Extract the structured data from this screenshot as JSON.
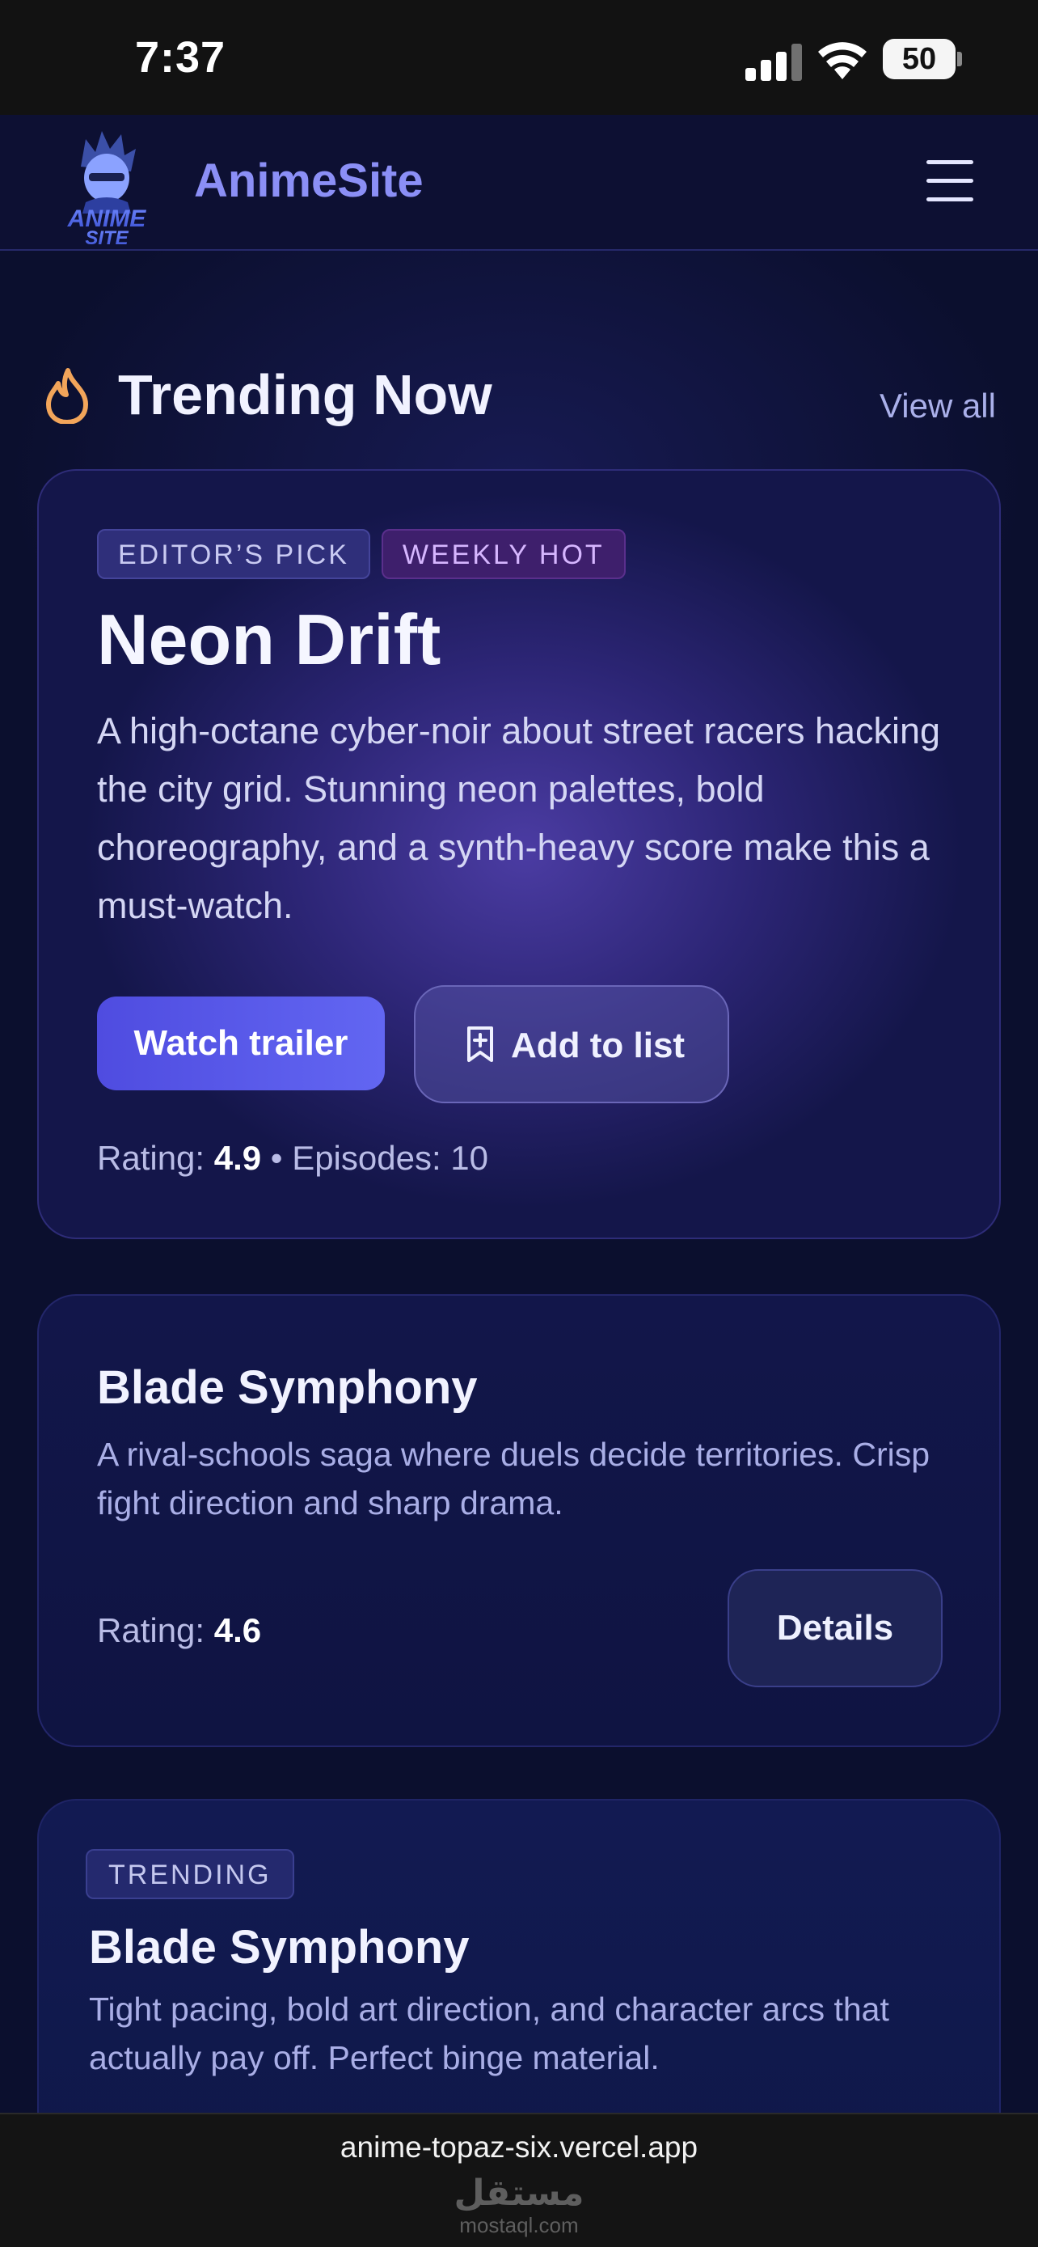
{
  "status_bar": {
    "time": "7:37",
    "battery": "50"
  },
  "header": {
    "logo_text_line1": "ANIME",
    "logo_text_line2": "SITE",
    "brand": "AnimeSite"
  },
  "section": {
    "title": "Trending Now",
    "view_all": "View all"
  },
  "featured": {
    "badges": [
      "EDITOR’S PICK",
      "WEEKLY HOT"
    ],
    "title": "Neon Drift",
    "description": "A high-octane cyber-noir about street racers hacking the city grid. Stunning neon palettes, bold choreography, and a synth-heavy score make this a must-watch.",
    "watch_trailer": "Watch trailer",
    "add_to_list": "Add to list",
    "rating_label": "Rating: ",
    "rating": "4.9",
    "separator": " • ",
    "episodes": "Episodes: 10"
  },
  "card_blade": {
    "title": "Blade Symphony",
    "description": "A rival-schools saga where duels decide territories. Crisp fight direction and sharp drama.",
    "rating_label": "Rating: ",
    "rating": "4.6",
    "details": "Details"
  },
  "card_trending": {
    "badge": "TRENDING",
    "title": "Blade Symphony",
    "description": "Tight pacing, bold art direction, and character arcs that actually pay off. Perfect binge material."
  },
  "browser": {
    "url": "anime-topaz-six.vercel.app",
    "watermark_arabic": "مستقل",
    "watermark_latin": "mostaql.com"
  },
  "colors": {
    "accent": "#5b5cf0",
    "background": "#0b0f2e",
    "brand": "#8b8ff6",
    "fire": "#f2a55a"
  },
  "icons": [
    "fire-icon",
    "menu-icon",
    "bookmark-plus-icon",
    "wifi-icon",
    "signal-icon",
    "battery-icon"
  ]
}
